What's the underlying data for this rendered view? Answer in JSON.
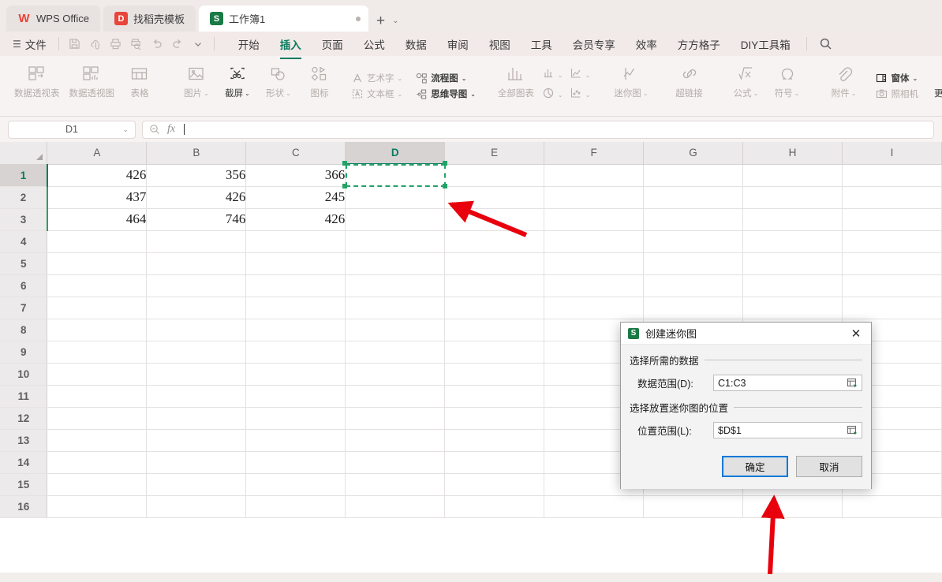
{
  "window": {
    "tabs": [
      {
        "label": "WPS Office",
        "icon": "wps-logo-icon",
        "state": "inactive"
      },
      {
        "label": "找稻壳模板",
        "icon": "template-icon",
        "state": "inactive"
      },
      {
        "label": "工作簿1",
        "icon": "spreadsheet-icon",
        "state": "active"
      }
    ],
    "new_tab_label": "+",
    "tab_dropdown_label": "⌄"
  },
  "menubar": {
    "file_label": "文件",
    "quick_access": [
      "save-icon",
      "save-as-cloud-icon",
      "print-icon",
      "print-preview-icon",
      "undo-icon",
      "redo-icon",
      "customize-chevron-icon"
    ],
    "items": [
      {
        "label": "开始",
        "selected": false
      },
      {
        "label": "插入",
        "selected": true
      },
      {
        "label": "页面",
        "selected": false
      },
      {
        "label": "公式",
        "selected": false
      },
      {
        "label": "数据",
        "selected": false
      },
      {
        "label": "审阅",
        "selected": false
      },
      {
        "label": "视图",
        "selected": false
      },
      {
        "label": "工具",
        "selected": false
      },
      {
        "label": "会员专享",
        "selected": false
      },
      {
        "label": "效率",
        "selected": false
      },
      {
        "label": "方方格子",
        "selected": false
      },
      {
        "label": "DIY工具箱",
        "selected": false
      }
    ],
    "search_icon": "search-icon"
  },
  "ribbon": {
    "pivot_table": "数据透视表",
    "pivot_chart": "数据透视图",
    "table": "表格",
    "picture": "图片",
    "screenshot": "截屏",
    "shape": "形状",
    "icon_lib": "图标",
    "wordart": "艺术字",
    "textbox": "文本框",
    "flowchart": "流程图",
    "mindmap": "思维导图",
    "all_charts": "全部图表",
    "sparkline": "迷你图",
    "hyperlink": "超链接",
    "formula": "公式",
    "symbol": "符号",
    "attachment": "附件",
    "camera": "照相机",
    "form": "窗体",
    "more_material": "更多素材"
  },
  "formula_bar": {
    "name_box_value": "D1",
    "formula_value": "",
    "fx_label": "fx",
    "zoom_icon": "zoom-out-icon",
    "chevron_icon": "chevron-down-icon"
  },
  "sheet": {
    "columns": [
      "A",
      "B",
      "C",
      "D",
      "E",
      "F",
      "G",
      "H",
      "I"
    ],
    "selected_column": "D",
    "rows": [
      1,
      2,
      3,
      4,
      5,
      6,
      7,
      8,
      9,
      10,
      11,
      12,
      13,
      14,
      15,
      16
    ],
    "selected_row": 1,
    "data": [
      [
        "426",
        "356",
        "366",
        "",
        "",
        "",
        "",
        "",
        ""
      ],
      [
        "437",
        "426",
        "245",
        "",
        "",
        "",
        "",
        "",
        ""
      ],
      [
        "464",
        "746",
        "426",
        "",
        "",
        "",
        "",
        "",
        ""
      ]
    ],
    "active_cell": "D1"
  },
  "dialog": {
    "icon": "spreadsheet-icon",
    "title": "创建迷你图",
    "close_label": "✕",
    "group1_label": "选择所需的数据",
    "data_range_label": "数据范围(D):",
    "data_range_value": "C1:C3",
    "group2_label": "选择放置迷你图的位置",
    "location_label": "位置范围(L):",
    "location_value": "$D$1",
    "picker_icon": "range-picker-icon",
    "ok_label": "确定",
    "cancel_label": "取消"
  },
  "annotations": {
    "arrow_color": "#e8000d",
    "arrows": [
      {
        "name": "arrow-to-selected-cell",
        "points_to": "D1"
      },
      {
        "name": "arrow-to-location-field",
        "points_to": "位置范围(L)"
      },
      {
        "name": "arrow-to-ok-button",
        "points_to": "确定"
      }
    ]
  },
  "colors": {
    "accent_green": "#0a7b5f",
    "selection_green": "#21a366",
    "focus_blue": "#0078d7",
    "chrome_bg": "#f2eeec"
  }
}
